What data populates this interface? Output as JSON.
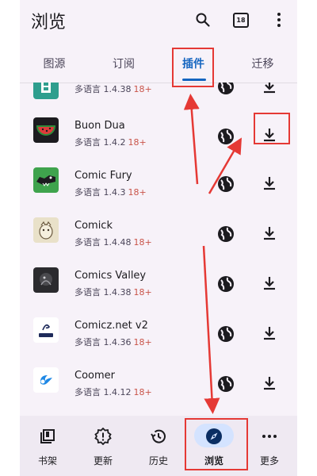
{
  "header": {
    "title": "浏览",
    "calendar_badge": "18"
  },
  "tabs": [
    "图源",
    "订阅",
    "插件",
    "迁移"
  ],
  "active_tab": "插件",
  "extensions": [
    {
      "name": "",
      "lang": "多语言",
      "version": "1.4.38",
      "age": "18+",
      "icon": "partial-teal-icon"
    },
    {
      "name": "Buon Dua",
      "lang": "多语言",
      "version": "1.4.2",
      "age": "18+",
      "icon": "watermelon-icon"
    },
    {
      "name": "Comic Fury",
      "lang": "多语言",
      "version": "1.4.3",
      "age": "18+",
      "icon": "crocodile-icon"
    },
    {
      "name": "Comick",
      "lang": "多语言",
      "version": "1.4.48",
      "age": "18+",
      "icon": "comick-mascot-icon"
    },
    {
      "name": "Comics Valley",
      "lang": "多语言",
      "version": "1.4.38",
      "age": "18+",
      "icon": "comics-valley-icon"
    },
    {
      "name": "Comicz.net v2",
      "lang": "多语言",
      "version": "1.4.36",
      "age": "18+",
      "icon": "comicz-logo-icon"
    },
    {
      "name": "Coomer",
      "lang": "多语言",
      "version": "1.4.12",
      "age": "18+",
      "icon": "coomer-logo-icon"
    }
  ],
  "bottom_nav": [
    {
      "label": "书架",
      "icon": "library-icon"
    },
    {
      "label": "更新",
      "icon": "alert-badge-icon"
    },
    {
      "label": "历史",
      "icon": "history-icon"
    },
    {
      "label": "浏览",
      "icon": "compass-icon"
    },
    {
      "label": "更多",
      "icon": "more-horizontal-icon"
    }
  ],
  "colors": {
    "accent": "#1565c0",
    "age_badge": "#c9544a",
    "annotation": "#e53935",
    "nav_pill": "#d4e3ff"
  }
}
